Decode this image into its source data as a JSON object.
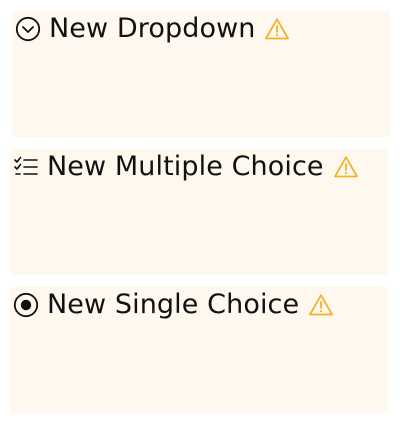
{
  "accent_warning_color": "#f0b429",
  "card_background": "#fef8ee",
  "cards": [
    {
      "title": "New Dropdown",
      "type_icon": "chevron-circle-down-icon",
      "warning_icon": "warning-triangle-icon"
    },
    {
      "title": "New Multiple Choice",
      "type_icon": "checklist-icon",
      "warning_icon": "warning-triangle-icon"
    },
    {
      "title": "New Single Choice",
      "type_icon": "radio-selected-icon",
      "warning_icon": "warning-triangle-icon"
    }
  ]
}
